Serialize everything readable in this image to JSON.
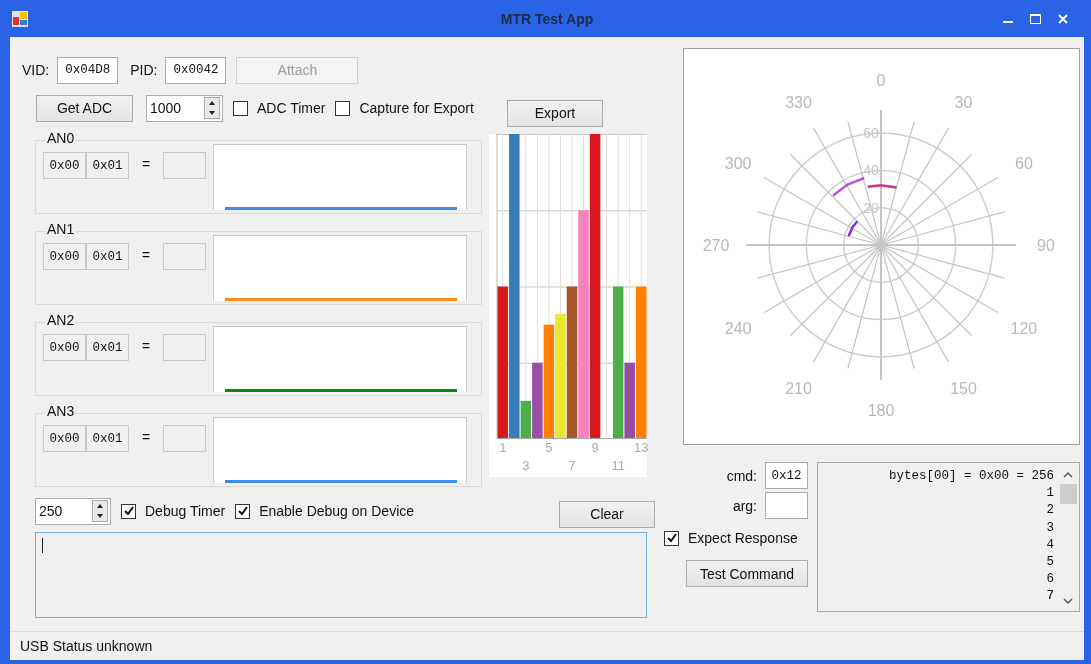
{
  "window": {
    "title": "MTR Test App"
  },
  "device": {
    "vid_label": "VID:",
    "vid": "0x04D8",
    "pid_label": "PID:",
    "pid": "0x0042",
    "attach_button": {
      "label": "Attach",
      "disabled": true
    }
  },
  "adc": {
    "get_button": "Get ADC",
    "interval": "1000",
    "adc_timer": {
      "label": "ADC Timer",
      "checked": false
    },
    "capture": {
      "label": "Capture for Export",
      "checked": false
    },
    "export_button": "Export"
  },
  "channels": [
    {
      "name": "AN0",
      "byte_0": "0x00",
      "byte_1": "0x01",
      "equals": "=",
      "color": "#3b8de8"
    },
    {
      "name": "AN1",
      "byte_0": "0x00",
      "byte_1": "0x01",
      "equals": "=",
      "color": "#ff8c1a"
    },
    {
      "name": "AN2",
      "byte_0": "0x00",
      "byte_1": "0x01",
      "equals": "=",
      "color": "#0a8a0a"
    },
    {
      "name": "AN3",
      "byte_0": "0x00",
      "byte_1": "0x01",
      "equals": "=",
      "color": "#3b8de8"
    }
  ],
  "bar_chart": {
    "x_labels": [
      "1",
      "3",
      "5",
      "7",
      "9",
      "11",
      "13"
    ]
  },
  "polar_chart": {
    "angle_labels": [
      "0",
      "30",
      "60",
      "90",
      "120",
      "150",
      "180",
      "210",
      "240",
      "270",
      "300",
      "330"
    ],
    "radius_labels": [
      "60",
      "40",
      "20"
    ]
  },
  "debug": {
    "interval": "250",
    "debug_timer": {
      "label": "Debug Timer",
      "checked": true
    },
    "enable_debug": {
      "label": "Enable Debug on Device",
      "checked": true
    },
    "clear_button": "Clear"
  },
  "command": {
    "cmd_label": "cmd:",
    "cmd": "0x12",
    "arg_label": "arg:",
    "expect_response": {
      "label": "Expect Response",
      "checked": true
    },
    "test_button": "Test Command"
  },
  "bytes_list": [
    "bytes[00] = 0x00 = 256",
    "1",
    "2",
    "3",
    "4",
    "5",
    "6",
    "7"
  ],
  "status_bar": "USB Status unknown"
}
